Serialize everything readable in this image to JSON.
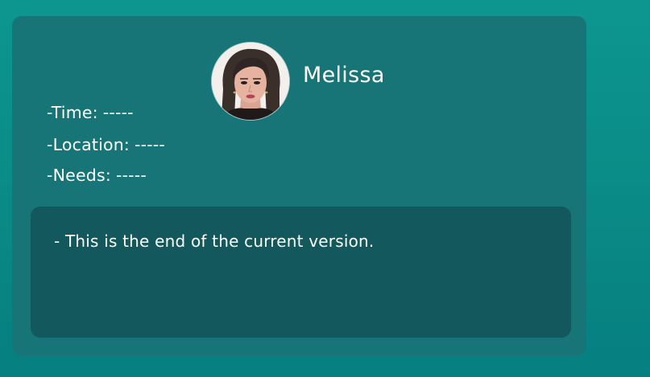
{
  "character": {
    "name": "Melissa",
    "avatar_icon": "woman-portrait"
  },
  "info": {
    "time_label": "-Time:",
    "time_value": "-----",
    "location_label": "-Location:",
    "location_value": "-----",
    "needs_label": "-Needs:",
    "needs_value": "-----"
  },
  "message": {
    "text": "- This is the end of the current version."
  },
  "colors": {
    "background": "#0a8d89",
    "card": "#177577",
    "message_box": "#12585c",
    "text": "#ffffff"
  }
}
